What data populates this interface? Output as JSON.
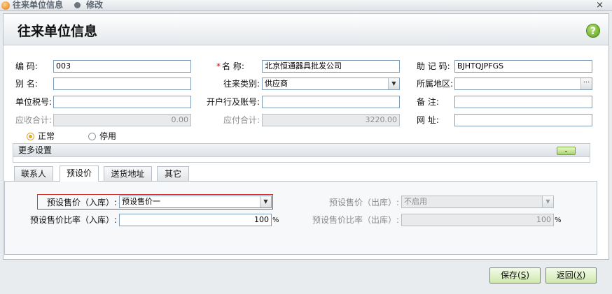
{
  "window": {
    "title": "往来单位信息",
    "mode": "修改",
    "close": "×"
  },
  "header": {
    "title": "往来单位信息",
    "help": "?"
  },
  "form": {
    "code_label": "编      码:",
    "code_value": "003",
    "name_label": "名      称:",
    "name_required": "*",
    "name_value": "北京恒通器具批发公司",
    "mnemonic_label": "助 记 码:",
    "mnemonic_value": "BJHTQJPFGS",
    "alias_label": "别      名:",
    "alias_value": "",
    "category_label": "往来类别:",
    "category_value": "供应商",
    "region_label": "所属地区:",
    "region_value": "",
    "tax_label": "单位税号:",
    "tax_value": "",
    "bank_label": "开户行及账号:",
    "bank_value": "",
    "remark_label": "备      注:",
    "remark_value": "",
    "receivable_label": "应收合计:",
    "receivable_value": "0.00",
    "payable_label": "应付合计:",
    "payable_value": "3220.00",
    "website_label": "网      址:",
    "website_value": "",
    "status_normal": "正常",
    "status_disabled": "停用",
    "browse": "···"
  },
  "more_settings": {
    "label": "更多设置",
    "expand": "⌄"
  },
  "tabs": [
    "联系人",
    "预设价",
    "送货地址",
    "其它"
  ],
  "preset": {
    "in_price_label": "预设售价（入库）:",
    "in_price_value": "预设售价一",
    "out_price_label": "预设售价（出库）:",
    "out_price_value": "不启用",
    "in_ratio_label": "预设售价比率（入库）:",
    "in_ratio_value": "100",
    "out_ratio_label": "预设售价比率（出库）:",
    "out_ratio_value": "100",
    "percent": "%"
  },
  "buttons": {
    "save_label": "保存(",
    "save_key": "S",
    "save_end": ")",
    "back_label": "返回(",
    "back_key": "X",
    "back_end": ")"
  },
  "icons": {
    "logo": "app-logo-icon",
    "close": "close-icon",
    "help": "help-icon",
    "dropdown": "chevron-down-icon",
    "browse": "ellipsis-icon"
  }
}
